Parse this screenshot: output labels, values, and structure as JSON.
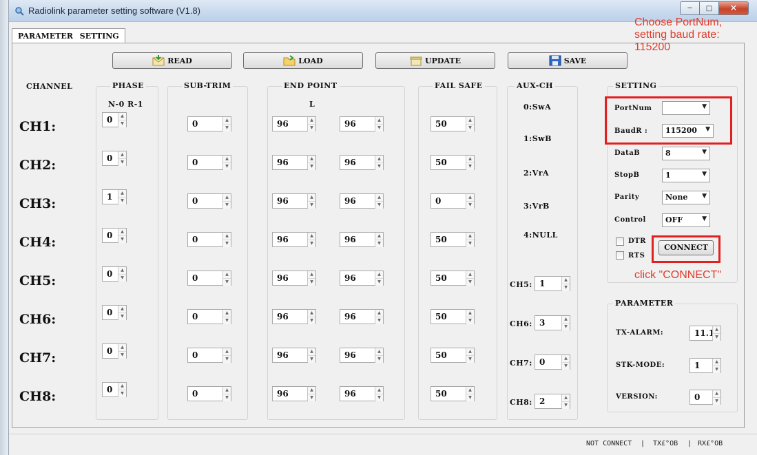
{
  "window": {
    "title": "Radiolink parameter setting software (V1.8)"
  },
  "tab": {
    "label": "PARAMETER SETTING"
  },
  "toolbar": [
    {
      "label": "READ",
      "icon": "envelope-icon"
    },
    {
      "label": "LOAD",
      "icon": "folder-icon"
    },
    {
      "label": "UPDATE",
      "icon": "box-icon"
    },
    {
      "label": "SAVE",
      "icon": "floppy-icon"
    }
  ],
  "columns": {
    "channel": "CHANNEL",
    "phase": "PHASE",
    "phase_sub": "N-0 R-1",
    "subtrim": "SUB-TRIM",
    "endpoint": "END POINT",
    "endpoint_sub": "L",
    "failsafe": "FAIL SAFE",
    "auxch": "AUX-CH"
  },
  "channels": [
    {
      "label": "CH1:",
      "phase": "0",
      "subtrim": "0",
      "ep_l": "96",
      "ep_r": "96",
      "failsafe": "50"
    },
    {
      "label": "CH2:",
      "phase": "0",
      "subtrim": "0",
      "ep_l": "96",
      "ep_r": "96",
      "failsafe": "50"
    },
    {
      "label": "CH3:",
      "phase": "1",
      "subtrim": "0",
      "ep_l": "96",
      "ep_r": "96",
      "failsafe": "0"
    },
    {
      "label": "CH4:",
      "phase": "0",
      "subtrim": "0",
      "ep_l": "96",
      "ep_r": "96",
      "failsafe": "50"
    },
    {
      "label": "CH5:",
      "phase": "0",
      "subtrim": "0",
      "ep_l": "96",
      "ep_r": "96",
      "failsafe": "50"
    },
    {
      "label": "CH6:",
      "phase": "0",
      "subtrim": "0",
      "ep_l": "96",
      "ep_r": "96",
      "failsafe": "50"
    },
    {
      "label": "CH7:",
      "phase": "0",
      "subtrim": "0",
      "ep_l": "96",
      "ep_r": "96",
      "failsafe": "50"
    },
    {
      "label": "CH8:",
      "phase": "0",
      "subtrim": "0",
      "ep_l": "96",
      "ep_r": "96",
      "failsafe": "50"
    }
  ],
  "aux_legend": [
    "0:SwA",
    "1:SwB",
    "2:VrA",
    "3:VrB",
    "4:NULL"
  ],
  "aux_channels": [
    {
      "label": "CH5:",
      "value": "1"
    },
    {
      "label": "CH6:",
      "value": "3"
    },
    {
      "label": "CH7:",
      "value": "0"
    },
    {
      "label": "CH8:",
      "value": "2"
    }
  ],
  "setting": {
    "title": "SETTING",
    "portnum_label": "PortNum",
    "portnum_value": "",
    "baud_label": "BaudR :",
    "baud_value": "115200",
    "datab_label": "DataB",
    "datab_value": "8",
    "stopb_label": "StopB",
    "stopb_value": "1",
    "parity_label": "Parity",
    "parity_value": "None",
    "control_label": "Control",
    "control_value": "OFF",
    "dtr_label": "DTR",
    "rts_label": "RTS",
    "connect_label": "CONNECT"
  },
  "parameter": {
    "title": "PARAMETER",
    "tx_alarm_label": "TX-ALARM:",
    "tx_alarm_value": "11.1",
    "stk_mode_label": "STK-MODE:",
    "stk_mode_value": "1",
    "version_label": "VERSION:",
    "version_value": "0"
  },
  "annotations": {
    "top_lines": [
      "Choose PortNum,",
      "setting baud rate:",
      "115200"
    ],
    "connect_hint": "click \"CONNECT\""
  },
  "status": {
    "connection": "NOT CONNECT",
    "tx": "TX£°OB",
    "rx": "RX£°OB",
    "sep": "|"
  },
  "colors": {
    "annotation": "#e03b2a",
    "highlight_box": "#e12020"
  }
}
